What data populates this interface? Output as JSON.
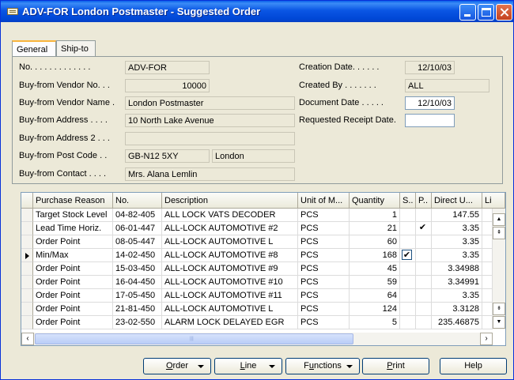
{
  "window": {
    "title": "ADV-FOR London Postmaster - Suggested Order"
  },
  "tabs": [
    {
      "label": "General"
    },
    {
      "label": "Ship-to"
    }
  ],
  "fields": {
    "no": {
      "label": "No. . . . . . . . . . . . .",
      "value": "ADV-FOR"
    },
    "vendor_no": {
      "label": "Buy-from Vendor No. . .",
      "value": "10000"
    },
    "vendor_name": {
      "label": "Buy-from Vendor Name .",
      "value": "London Postmaster"
    },
    "address": {
      "label": "Buy-from Address . . . .",
      "value": "10 North Lake Avenue"
    },
    "address2": {
      "label": "Buy-from Address 2 . . .",
      "value": ""
    },
    "post_code": {
      "label": "Buy-from Post Code . .",
      "value": "GB-N12 5XY",
      "city": "London"
    },
    "contact": {
      "label": "Buy-from Contact . . . .",
      "value": "Mrs. Alana Lemlin"
    },
    "creation_date": {
      "label": "Creation Date. . . . . .",
      "value": "12/10/03"
    },
    "created_by": {
      "label": "Created By . . . . . . .",
      "value": "ALL"
    },
    "document_date": {
      "label": "Document Date . . . . .",
      "value": "12/10/03"
    },
    "requested_receipt": {
      "label": "Requested Receipt Date.",
      "value": ""
    }
  },
  "grid": {
    "columns": [
      "Purchase Reason",
      "No.",
      "Description",
      "Unit of M...",
      "Quantity",
      "S..",
      "P..",
      "Direct U...",
      "Li"
    ],
    "rows": [
      {
        "reason": "Target Stock Level",
        "no": "04-82-405",
        "desc": "ALL LOCK VATS DECODER",
        "unit": "PCS",
        "qty": "1",
        "s": "",
        "p": "",
        "price": "147.55"
      },
      {
        "reason": "Lead Time Horiz.",
        "no": "06-01-447",
        "desc": "ALL-LOCK AUTOMOTIVE #2",
        "unit": "PCS",
        "qty": "21",
        "s": "",
        "p": "✔",
        "price": "3.35"
      },
      {
        "reason": "Order Point",
        "no": "08-05-447",
        "desc": "ALL-LOCK AUTOMOTIVE L",
        "unit": "PCS",
        "qty": "60",
        "s": "",
        "p": "",
        "price": "3.35"
      },
      {
        "reason": "Min/Max",
        "no": "14-02-450",
        "desc": "ALL-LOCK AUTOMOTIVE #8",
        "unit": "PCS",
        "qty": "168",
        "s": "✔",
        "p": "",
        "price": "3.35"
      },
      {
        "reason": "Order Point",
        "no": "15-03-450",
        "desc": "ALL-LOCK AUTOMOTIVE #9",
        "unit": "PCS",
        "qty": "45",
        "s": "",
        "p": "",
        "price": "3.34988"
      },
      {
        "reason": "Order Point",
        "no": "16-04-450",
        "desc": "ALL-LOCK AUTOMOTIVE #10",
        "unit": "PCS",
        "qty": "59",
        "s": "",
        "p": "",
        "price": "3.34991"
      },
      {
        "reason": "Order Point",
        "no": "17-05-450",
        "desc": "ALL-LOCK AUTOMOTIVE #11",
        "unit": "PCS",
        "qty": "64",
        "s": "",
        "p": "",
        "price": "3.35"
      },
      {
        "reason": "Order Point",
        "no": "21-81-450",
        "desc": "ALL-LOCK AUTOMOTIVE L",
        "unit": "PCS",
        "qty": "124",
        "s": "",
        "p": "",
        "price": "3.3128"
      },
      {
        "reason": "Order Point",
        "no": "23-02-550",
        "desc": "ALARM LOCK DELAYED EGR",
        "unit": "PCS",
        "qty": "5",
        "s": "",
        "p": "",
        "price": "235.46875"
      }
    ]
  },
  "buttons": {
    "order": {
      "pre": "",
      "key": "O",
      "post": "rder"
    },
    "line": {
      "pre": "",
      "key": "L",
      "post": "ine"
    },
    "functions": {
      "pre": "F",
      "key": "u",
      "post": "nctions"
    },
    "print": {
      "pre": "",
      "key": "P",
      "post": "rint"
    },
    "help": {
      "label": "Help"
    }
  },
  "colors": {
    "titlebar": "#0a56e4",
    "window_bg": "#ece9d8",
    "grid_border": "#7f9db9"
  }
}
